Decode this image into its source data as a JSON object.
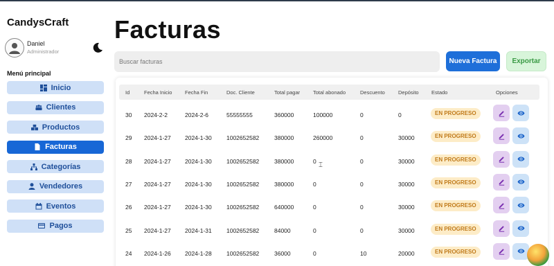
{
  "brand": "CandysCraft",
  "user": {
    "name": "Daniel",
    "role": "Administrador"
  },
  "menu": {
    "title": "Menú principal",
    "items": [
      {
        "label": "Inicio",
        "icon": "dashboard-icon",
        "active": false
      },
      {
        "label": "Clientes",
        "icon": "users-icon",
        "active": false
      },
      {
        "label": "Productos",
        "icon": "boxes-icon",
        "active": false
      },
      {
        "label": "Facturas",
        "icon": "file-icon",
        "active": true
      },
      {
        "label": "Categorías",
        "icon": "sitemap-icon",
        "active": false
      },
      {
        "label": "Vendedores",
        "icon": "user-icon",
        "active": false
      },
      {
        "label": "Eventos",
        "icon": "calendar-icon",
        "active": false
      },
      {
        "label": "Pagos",
        "icon": "card-icon",
        "active": false
      }
    ]
  },
  "page": {
    "title": "Facturas",
    "search_placeholder": "Buscar facturas",
    "new_label": "Nueva Factura",
    "export_label": "Exportar"
  },
  "table": {
    "headers": [
      "Id",
      "Fecha Inicio",
      "Fecha Fin",
      "Doc. Cliente",
      "Total pagar",
      "Total abonado",
      "Descuento",
      "Depósito",
      "Estado",
      "Opciones"
    ],
    "rows": [
      [
        "30",
        "2024-2-2",
        "2024-2-6",
        "55555555",
        "360000",
        "100000",
        "0",
        "0",
        "EN PROGRESO"
      ],
      [
        "29",
        "2024-1-27",
        "2024-1-30",
        "1002652582",
        "380000",
        "260000",
        "0",
        "30000",
        "EN PROGRESO"
      ],
      [
        "28",
        "2024-1-27",
        "2024-1-30",
        "1002652582",
        "380000",
        "0",
        "0",
        "30000",
        "EN PROGRESO"
      ],
      [
        "27",
        "2024-1-27",
        "2024-1-30",
        "1002652582",
        "380000",
        "0",
        "0",
        "30000",
        "EN PROGRESO"
      ],
      [
        "26",
        "2024-1-27",
        "2024-1-30",
        "1002652582",
        "640000",
        "0",
        "0",
        "30000",
        "EN PROGRESO"
      ],
      [
        "25",
        "2024-1-27",
        "2024-1-31",
        "1002652582",
        "84000",
        "0",
        "0",
        "30000",
        "EN PROGRESO"
      ],
      [
        "24",
        "2024-1-26",
        "2024-1-28",
        "1002652582",
        "36000",
        "0",
        "10",
        "20000",
        "EN PROGRESO"
      ]
    ]
  },
  "colors": {
    "accent": "#1767d6",
    "menu_bg": "#cfe0f7",
    "badge_bg": "#fdecc7",
    "badge_text": "#c07a1a",
    "edit_bg": "#e3cff0",
    "view_bg": "#cde2f7"
  }
}
